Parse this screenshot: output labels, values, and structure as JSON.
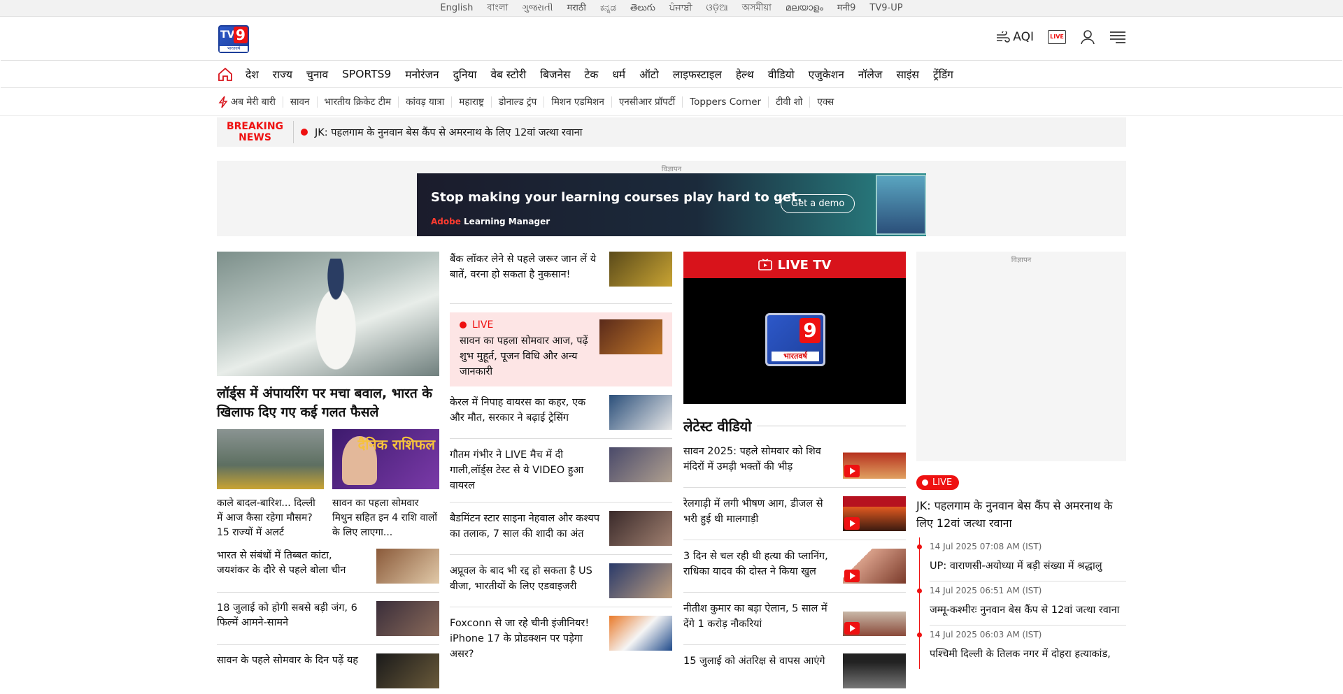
{
  "lang_bar": [
    "English",
    "বাংলা",
    "ગુજરાતી",
    "मराठी",
    "ಕನ್ನಡ",
    "తెలుగు",
    "ਪੰਜਾਬੀ",
    "ଓଡ଼ିଆ",
    "অসমীয়া",
    "മലയാളം",
    "मनी9",
    "TV9-UP"
  ],
  "header": {
    "logo_sub": "भारतवर्ष",
    "aqi_label": "AQI",
    "live_label": "LIVE"
  },
  "main_nav": [
    "देश",
    "राज्य",
    "चुनाव",
    "SPORTS9",
    "मनोरंजन",
    "दुनिया",
    "वेब स्टोरी",
    "बिजनेस",
    "टेक",
    "धर्म",
    "ऑटो",
    "लाइफस्टाइल",
    "हेल्थ",
    "वीडियो",
    "एजुकेशन",
    "नॉलेज",
    "साइंस",
    "ट्रेंडिंग"
  ],
  "trending": [
    "अब मेरी बारी",
    "सावन",
    "भारतीय क्रिकेट टीम",
    "कांवड़ यात्रा",
    "महाराष्ट्र",
    "डोनाल्ड ट्रंप",
    "मिशन एडमिशन",
    "एनसीआर प्रॉपर्टी",
    "Toppers Corner",
    "टीवी शो",
    "एक्स"
  ],
  "breaking": {
    "label_line1": "BREAKING",
    "label_line2": "NEWS",
    "text": "JK: पहलगाम के नुनवान बेस कैंप से अमरनाथ के लिए 12वां जत्था रवाना"
  },
  "ad": {
    "label": "विज्ञापन",
    "headline": "Stop making your learning courses play hard to get.",
    "cta": "Get a demo",
    "brand_red": "Adobe",
    "brand_rest": " Learning Manager"
  },
  "col1": {
    "hero_title": "लॉर्ड्स में अंपायरिंग पर मचा बवाल, भारत के खिलाफ दिए गए कई गलत फैसले",
    "cards": [
      {
        "caption": "काले बादल-बारिश... दिल्ली में आज कैसा रहेगा मौसम? 15 राज्यों में अलर्ट"
      },
      {
        "caption": "सावन का पहला सोमवार मिथुन सहित इन 4 राशि वालों के लिए लाएगा...",
        "thumb_text": "दैनिक राशिफल"
      }
    ],
    "rows": [
      "भारत से संबंधों में तिब्बत कांटा, जयशंकर के दौरे से पहले बोला चीन",
      "18 जुलाई को होगी सबसे बड़ी जंग, 6 फिल्में आमने-सामने",
      "सावन के पहले सोमवार के दिन पढ़ें यह"
    ]
  },
  "col2": {
    "first": "बैंक लॉकर लेने से पहले जरूर जान लें ये बातें, वरना हो सकता है नुकसान!",
    "live": {
      "label": "LIVE",
      "text": "सावन का पहला सोमवार आज, पढ़ें शुभ मुहूर्त, पूजन विधि और अन्य जानकारी"
    },
    "items": [
      "केरल में निपाह वायरस का कहर, एक और मौत, सरकार ने बढ़ाई ट्रेसिंग",
      "गौतम गंभीर ने LIVE मैच में दी गाली,लॉर्ड्स टेस्ट से ये VIDEO हुआ वायरल",
      "बैडमिंटन स्टार साइना नेहवाल और कश्यप का तलाक, 7 साल की शादी का अंत",
      "अप्रूवल के बाद भी रद्द हो सकता है US वीजा, भारतीयों के लिए एडवाइजरी",
      "Foxconn से जा रहे चीनी इंजीनियर! iPhone 17 के प्रोडक्शन पर पड़ेगा असर?"
    ]
  },
  "col3": {
    "live_tv": "LIVE TV",
    "logo_sub": "भारतवर्ष",
    "section_title": "लेटेस्ट वीडियो",
    "videos": [
      "सावन 2025: पहले सोमवार को शिव मंदिरों में उमड़ी भक्तों की भीड़",
      "रेलगाड़ी में लगी भीषण आग, डीजल से भरी हुई थी मालगाड़ी",
      "3 दिन से चल रही थी हत्या की प्लानिंग, राधिका यादव की दोस्त ने किया खुल",
      "नीतीश कुमार का बड़ा ऐलान, 5 साल में देंगे 1 करोड़ नौकरियां",
      "15 जुलाई को अंतरिक्ष से वापस आएंगे"
    ]
  },
  "col4": {
    "ad_label": "विज्ञापन",
    "live_label": "LIVE",
    "title": "JK: पहलगाम के नुनवान बेस कैंप से अमरनाथ के लिए 12वां जत्था रवाना",
    "updates": [
      {
        "time": "14 Jul 2025 07:08 AM (IST)",
        "text": "UP: वाराणसी-अयोध्या में बड़ी संख्या में श्रद्धालु"
      },
      {
        "time": "14 Jul 2025 06:51 AM (IST)",
        "text": "जम्मू-कश्मीरः नुनवान बेस कैंप से 12वां जत्था रवाना"
      },
      {
        "time": "14 Jul 2025 06:03 AM (IST)",
        "text": "पश्चिमी दिल्ली के तिलक नगर में दोहरा हत्याकांड,"
      }
    ]
  },
  "colors": {
    "brand_red": "#d8131b",
    "brand_blue": "#1d3f9a",
    "live_bg": "#fde5e5"
  }
}
